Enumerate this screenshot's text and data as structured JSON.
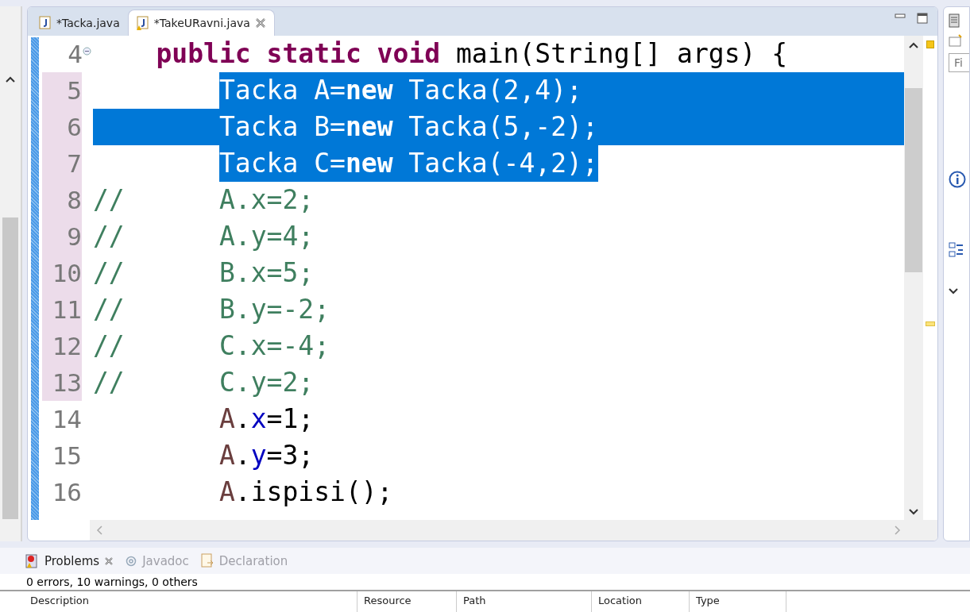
{
  "editor": {
    "tabs": [
      {
        "label": "*Tacka.java",
        "selected": false,
        "warning": false,
        "closable": false
      },
      {
        "label": "*TakeURavni.java",
        "selected": true,
        "warning": true,
        "closable": true
      }
    ],
    "lines": [
      {
        "number": "4",
        "kind": "method",
        "fold": true,
        "changed": false,
        "selected": false,
        "tokens": [
          {
            "kind": "keyword",
            "text": "public static void"
          },
          {
            "kind": "plain",
            "text": " main(String[] args) {"
          }
        ]
      },
      {
        "number": "5",
        "kind": "statement",
        "fold": false,
        "changed": true,
        "selected": true,
        "tokens": [
          {
            "kind": "plain",
            "text": "Tacka A="
          },
          {
            "kind": "keyword",
            "text": "new"
          },
          {
            "kind": "plain",
            "text": " Tacka(2,4);"
          }
        ]
      },
      {
        "number": "6",
        "kind": "statement",
        "fold": false,
        "changed": true,
        "selected": true,
        "tokens": [
          {
            "kind": "plain",
            "text": "Tacka B="
          },
          {
            "kind": "keyword",
            "text": "new"
          },
          {
            "kind": "plain",
            "text": " Tacka(5,-2);"
          }
        ]
      },
      {
        "number": "7",
        "kind": "statement",
        "fold": false,
        "changed": true,
        "selected": true,
        "tokens": [
          {
            "kind": "plain",
            "text": "Tacka C="
          },
          {
            "kind": "keyword",
            "text": "new"
          },
          {
            "kind": "plain",
            "text": " Tacka(-4,2);"
          }
        ]
      },
      {
        "number": "8",
        "kind": "comment",
        "fold": false,
        "changed": true,
        "selected": false,
        "tokens": [
          {
            "kind": "comment",
            "text": "//      A.x=2;"
          }
        ]
      },
      {
        "number": "9",
        "kind": "comment",
        "fold": false,
        "changed": true,
        "selected": false,
        "tokens": [
          {
            "kind": "comment",
            "text": "//      A.y=4;"
          }
        ]
      },
      {
        "number": "10",
        "kind": "comment",
        "fold": false,
        "changed": true,
        "selected": false,
        "tokens": [
          {
            "kind": "comment",
            "text": "//      B.x=5;"
          }
        ]
      },
      {
        "number": "11",
        "kind": "comment",
        "fold": false,
        "changed": true,
        "selected": false,
        "tokens": [
          {
            "kind": "comment",
            "text": "//      B.y=-2;"
          }
        ]
      },
      {
        "number": "12",
        "kind": "comment",
        "fold": false,
        "changed": true,
        "selected": false,
        "tokens": [
          {
            "kind": "comment",
            "text": "//      C.x=-4;"
          }
        ]
      },
      {
        "number": "13",
        "kind": "comment",
        "fold": false,
        "changed": true,
        "selected": false,
        "tokens": [
          {
            "kind": "comment",
            "text": "//      C.y=2;"
          }
        ]
      },
      {
        "number": "14",
        "kind": "statement",
        "fold": false,
        "changed": false,
        "selected": false,
        "tokens": [
          {
            "kind": "local",
            "text": "A"
          },
          {
            "kind": "plain",
            "text": "."
          },
          {
            "kind": "field",
            "text": "x"
          },
          {
            "kind": "plain",
            "text": "=1;"
          }
        ]
      },
      {
        "number": "15",
        "kind": "statement",
        "fold": false,
        "changed": false,
        "selected": false,
        "tokens": [
          {
            "kind": "local",
            "text": "A"
          },
          {
            "kind": "plain",
            "text": "."
          },
          {
            "kind": "field",
            "text": "y"
          },
          {
            "kind": "plain",
            "text": "=3;"
          }
        ]
      },
      {
        "number": "16",
        "kind": "statement",
        "fold": false,
        "changed": false,
        "selected": false,
        "tokens": [
          {
            "kind": "local",
            "text": "A"
          },
          {
            "kind": "plain",
            "text": ".ispisi();"
          }
        ]
      }
    ]
  },
  "side_panel": {
    "filter_field": {
      "placeholder": "Fi"
    }
  },
  "problems_view": {
    "tabs": [
      {
        "label": "Problems",
        "selected": true,
        "kind": "problems"
      },
      {
        "label": "Javadoc",
        "selected": false,
        "kind": "javadoc"
      },
      {
        "label": "Declaration",
        "selected": false,
        "kind": "declaration"
      }
    ],
    "summary": "0 errors, 10 warnings, 0 others",
    "columns": [
      "Description",
      "Resource",
      "Path",
      "Location",
      "Type"
    ]
  }
}
